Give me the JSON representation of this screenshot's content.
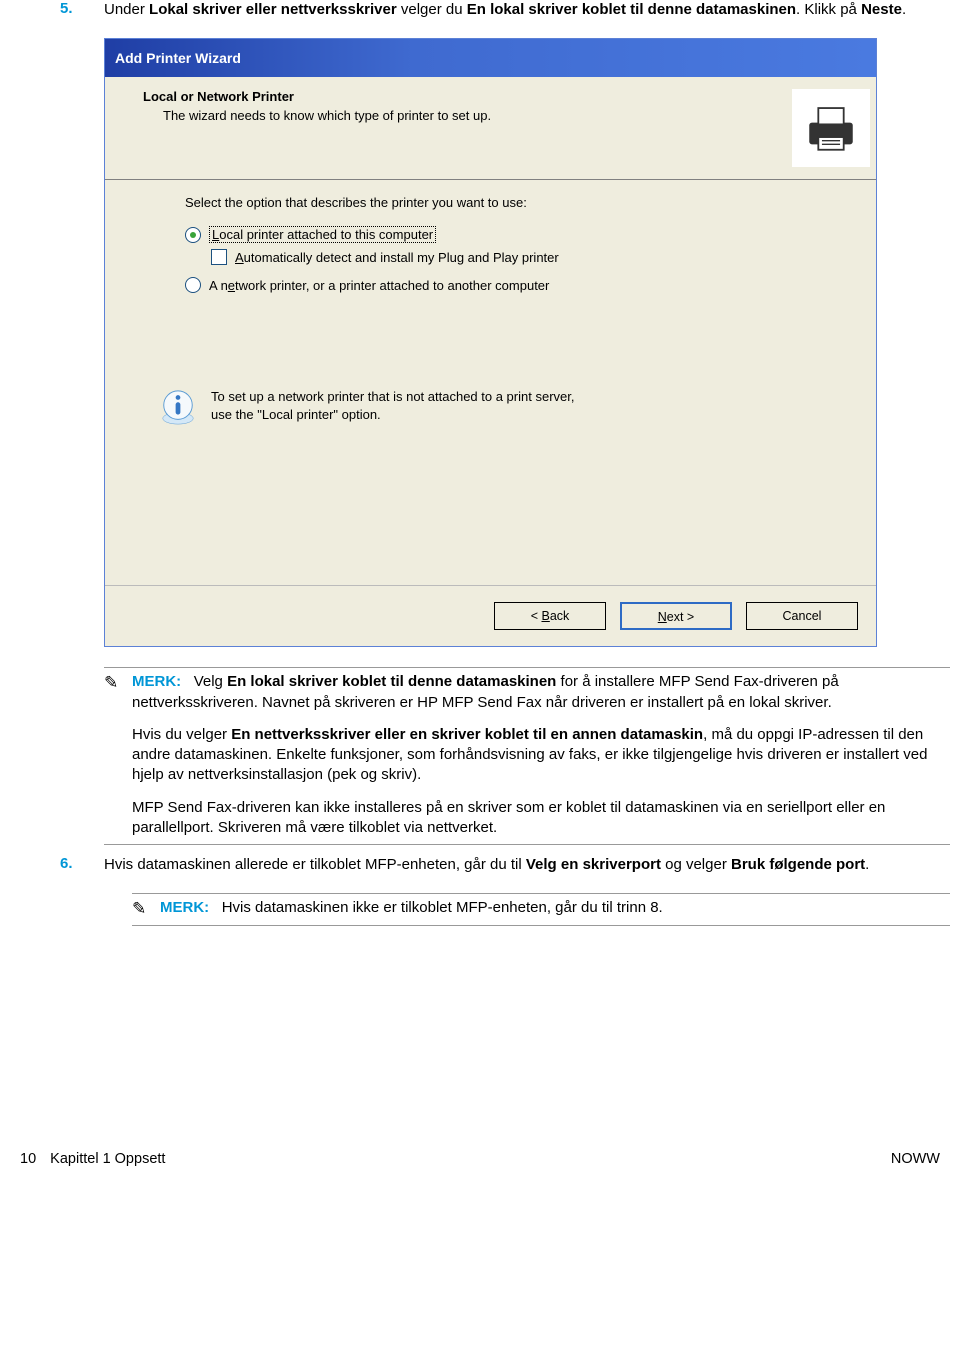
{
  "steps": {
    "five": {
      "number": "5.",
      "prefix": "Under ",
      "bold1": "Lokal skriver eller nettverksskriver",
      "mid1": " velger du ",
      "bold2": "En lokal skriver koblet til denne datamaskinen",
      "mid2": ". Klikk på ",
      "bold3": "Neste",
      "suffix": "."
    },
    "six": {
      "number": "6.",
      "prefix": "Hvis datamaskinen allerede er tilkoblet MFP-enheten, går du til ",
      "bold1": "Velg en skriverport",
      "mid1": " og velger ",
      "bold2": "Bruk følgende port",
      "suffix": "."
    }
  },
  "dialog": {
    "title": "Add Printer Wizard",
    "header_title": "Local or Network Printer",
    "header_subtitle": "The wizard needs to know which type of printer to set up.",
    "prompt": "Select the option that describes the printer you want to use:",
    "radio1": "Local printer attached to this computer",
    "checkbox1": "Automatically detect and install my Plug and Play printer",
    "radio2": "A network printer, or a printer attached to another computer",
    "info1": "To set up a network printer that is not attached to a print server,",
    "info2": "use the \"Local printer\" option.",
    "buttons": {
      "back": "< Back",
      "next": "Next >",
      "cancel": "Cancel"
    }
  },
  "note1": {
    "label": "MERK:",
    "p1_prefix": "Velg ",
    "p1_bold1": "En lokal skriver koblet til denne datamaskinen",
    "p1_rest": " for å installere MFP Send Fax-driveren på nettverksskriveren. Navnet på skriveren er HP MFP Send Fax når driveren er installert på en lokal skriver.",
    "p2_prefix": "Hvis du velger ",
    "p2_bold1": "En nettverksskriver eller en skriver koblet til en annen datamaskin",
    "p2_rest": ", må du oppgi IP-adressen til den andre datamaskinen. Enkelte funksjoner, som forhåndsvisning av faks, er ikke tilgjengelige hvis driveren er installert ved hjelp av nettverksinstallasjon (pek og skriv).",
    "p3": "MFP Send Fax-driveren kan ikke installeres på en skriver som er koblet til datamaskinen via en seriellport eller en parallellport. Skriveren må være tilkoblet via nettverket."
  },
  "note2": {
    "label": "MERK:",
    "text": "Hvis datamaskinen ikke er tilkoblet MFP-enheten, går du til trinn 8."
  },
  "footer": {
    "page_num": "10",
    "chapter": "Kapittel 1   Oppsett",
    "right": "NOWW"
  }
}
